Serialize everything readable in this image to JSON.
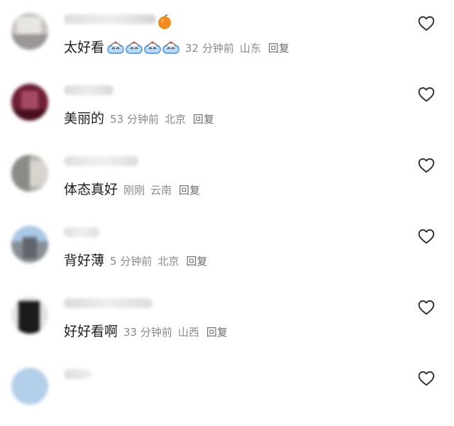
{
  "comments": [
    {
      "text": "太好看",
      "time": "32 分钟前",
      "location": "山东",
      "reply": "回复"
    },
    {
      "text": "美丽的",
      "time": "53 分钟前",
      "location": "北京",
      "reply": "回复"
    },
    {
      "text": "体态真好",
      "time": "刚刚",
      "location": "云南",
      "reply": "回复"
    },
    {
      "text": "背好薄",
      "time": "5 分钟前",
      "location": "北京",
      "reply": "回复"
    },
    {
      "text": "好好看啊",
      "time": "33 分钟前",
      "location": "山西",
      "reply": "回复"
    }
  ],
  "icons": {
    "like": "heart-icon",
    "username_decoration": "orange-icon",
    "reaction_emoji": "pinched-face-emoji"
  },
  "colors": {
    "comment_text": "#1d1d1d",
    "meta_text": "#8a8a8a",
    "reply_text": "#6d6d6d",
    "heart_stroke": "#2b2b2b",
    "emoji_blue": "#3f8fe6",
    "orange": "#f28a1d"
  }
}
